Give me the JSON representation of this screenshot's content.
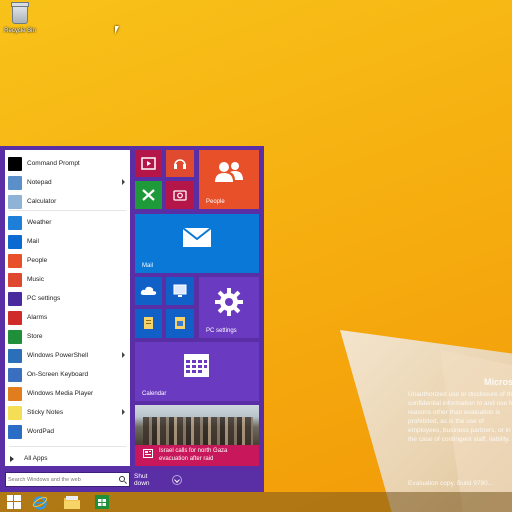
{
  "desktop": {
    "recycle_bin_label": "Recycle Bin",
    "watermark": {
      "title": "Microso",
      "body": "Unauthorized use or disclosure of this confidential information to and use for reasons other than evaluation is prohibited, as is the use of employees, business partners, or in the case of contingent staff, liability.",
      "build": "Evaluation copy. Build 9780..."
    }
  },
  "start_menu": {
    "apps": [
      {
        "label": "Command Prompt",
        "icon": "command-prompt-icon",
        "color": "#000000",
        "submenu": false
      },
      {
        "label": "Notepad",
        "icon": "notepad-icon",
        "color": "#5b8fc9",
        "submenu": true
      },
      {
        "label": "Calculator",
        "icon": "calculator-icon",
        "color": "#8fb3d6",
        "submenu": false
      },
      {
        "label": "Weather",
        "icon": "weather-icon",
        "color": "#1e7fd8",
        "submenu": false
      },
      {
        "label": "Mail",
        "icon": "mail-icon",
        "color": "#0a6ad1",
        "submenu": false
      },
      {
        "label": "People",
        "icon": "people-icon",
        "color": "#e8502a",
        "submenu": false
      },
      {
        "label": "Music",
        "icon": "music-icon",
        "color": "#e0472f",
        "submenu": false
      },
      {
        "label": "PC settings",
        "icon": "gear-icon",
        "color": "#4a2b9e",
        "submenu": false
      },
      {
        "label": "Alarms",
        "icon": "alarm-icon",
        "color": "#d12a2a",
        "submenu": false
      },
      {
        "label": "Store",
        "icon": "store-icon",
        "color": "#1f8f3a",
        "submenu": false
      },
      {
        "label": "Windows PowerShell",
        "icon": "powershell-icon",
        "color": "#2a6fb8",
        "submenu": true
      },
      {
        "label": "On-Screen Keyboard",
        "icon": "keyboard-icon",
        "color": "#3a6fc0",
        "submenu": false
      },
      {
        "label": "Windows Media Player",
        "icon": "media-player-icon",
        "color": "#e27d1d",
        "submenu": false
      },
      {
        "label": "Sticky Notes",
        "icon": "sticky-notes-icon",
        "color": "#f3de55",
        "submenu": true
      },
      {
        "label": "WordPad",
        "icon": "wordpad-icon",
        "color": "#2b6cc4",
        "submenu": false
      }
    ],
    "all_apps_label": "All Apps",
    "search_placeholder": "Search Windows and the web",
    "shutdown_label": "Shut down",
    "tiles": {
      "people": "People",
      "mail": "Mail",
      "pc_settings": "PC settings",
      "calendar": "Calendar",
      "news": "Israel calls for north Gaza evacuation after raid"
    }
  },
  "colors": {
    "start_bg": "#5a2fa5",
    "accent_blue": "#0a78d7",
    "people_orange": "#e8502a",
    "tile_purple": "#6a3ac0"
  }
}
